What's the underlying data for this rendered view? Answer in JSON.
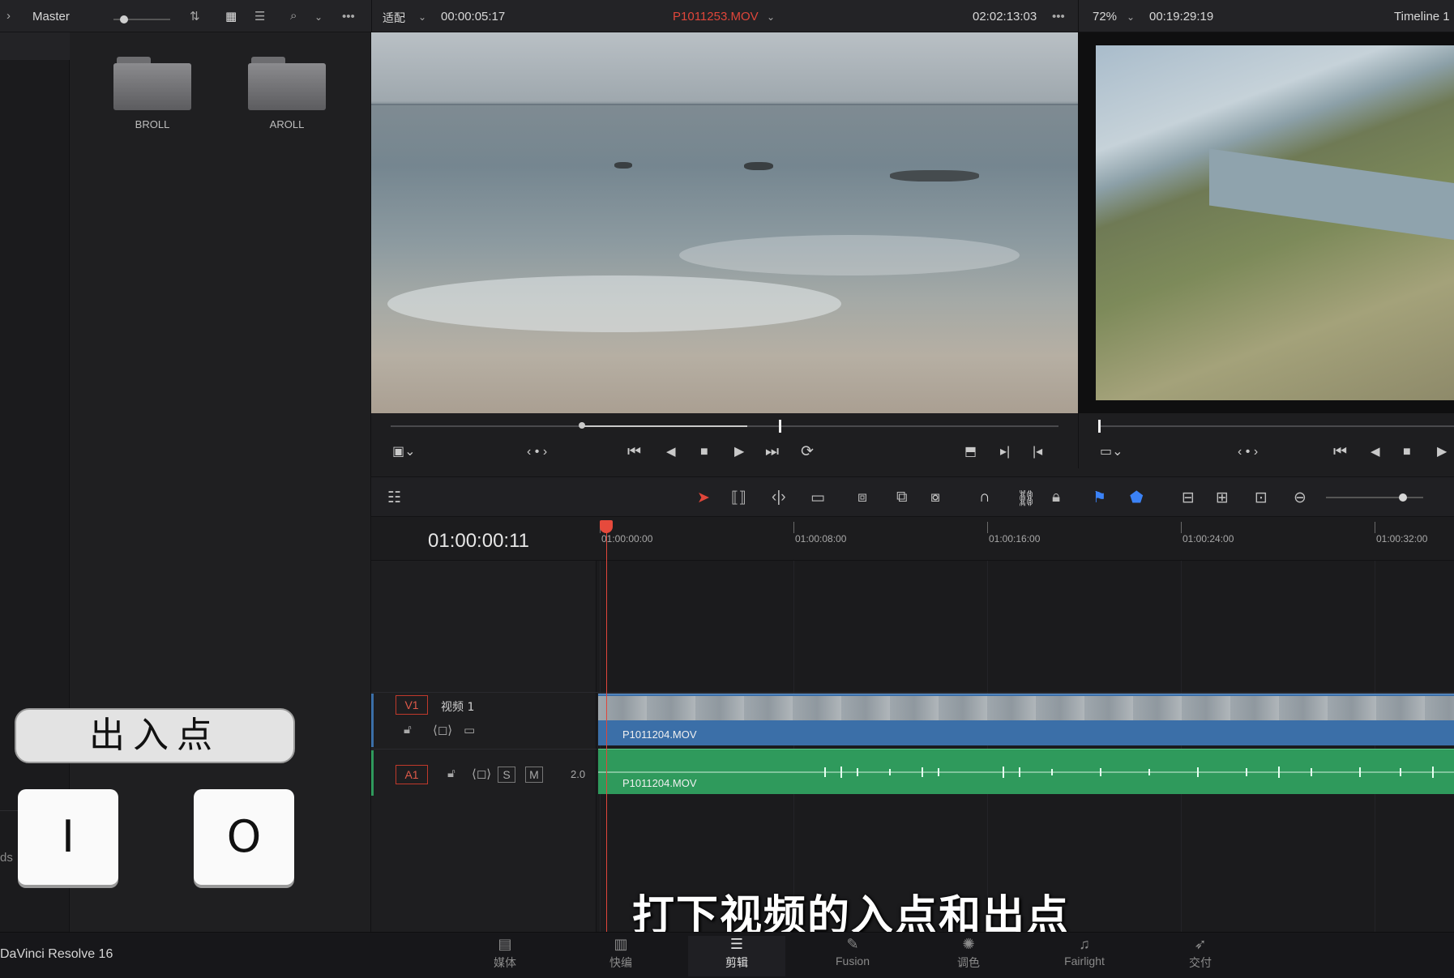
{
  "topbar": {
    "bin_name": "Master",
    "fit_label": "适配",
    "source_duration": "00:00:05:17",
    "clip_name": "P1011253.MOV",
    "source_timecode": "02:02:13:03",
    "zoom": "72%",
    "timeline_duration": "00:19:29:19",
    "timeline_name": "Timeline 1",
    "more": "•••"
  },
  "mediapool": {
    "folders": [
      {
        "label": "BROLL"
      },
      {
        "label": "AROLL"
      }
    ]
  },
  "overlay": {
    "title": "出入点",
    "key_in": "I",
    "key_out": "O",
    "side_fragment": "ds"
  },
  "timeline": {
    "timecode": "01:00:00:11",
    "ruler_labels": [
      "01:00:00:00",
      "01:00:08:00",
      "01:00:16:00",
      "01:00:24:00",
      "01:00:32:00"
    ],
    "video_track": {
      "badge": "V1",
      "name": "视频 1",
      "clip": "P1011204.MOV"
    },
    "audio_track": {
      "badge": "A1",
      "solo": "S",
      "mute": "M",
      "channels": "2.0",
      "clip": "P1011204.MOV"
    }
  },
  "subtitle": "打下视频的入点和出点",
  "pagebar": {
    "app_name": "DaVinci Resolve 16",
    "pages": [
      {
        "label": "媒体",
        "icon": "media-icon"
      },
      {
        "label": "快编",
        "icon": "cut-icon"
      },
      {
        "label": "剪辑",
        "icon": "edit-icon",
        "active": true
      },
      {
        "label": "Fusion",
        "icon": "fusion-icon"
      },
      {
        "label": "调色",
        "icon": "color-icon"
      },
      {
        "label": "Fairlight",
        "icon": "fairlight-icon"
      },
      {
        "label": "交付",
        "icon": "deliver-icon"
      }
    ]
  },
  "colors": {
    "accent_red": "#e0463a",
    "video_clip": "#3b6fa8",
    "audio_clip": "#2f9a5c"
  }
}
